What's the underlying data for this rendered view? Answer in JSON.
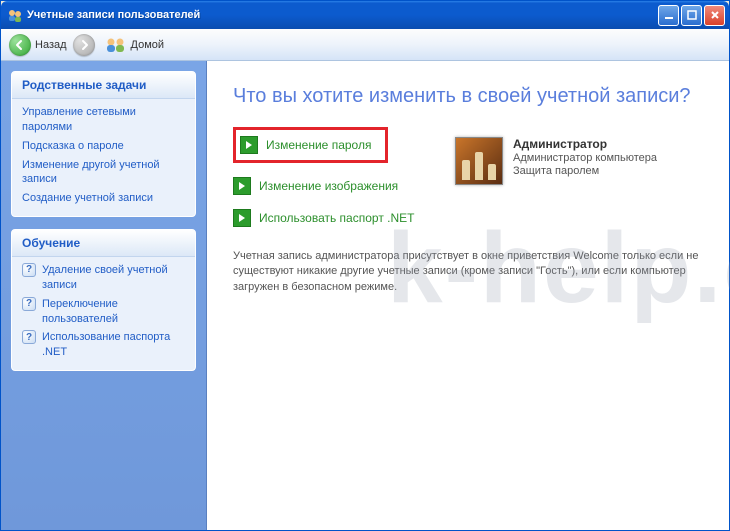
{
  "window": {
    "title": "Учетные записи пользователей"
  },
  "toolbar": {
    "back_label": "Назад",
    "home_label": "Домой"
  },
  "sidebar": {
    "panel1": {
      "title": "Родственные задачи",
      "links": [
        "Управление сетевыми паролями",
        "Подсказка о пароле",
        "Изменение другой учетной записи",
        "Создание учетной записи"
      ]
    },
    "panel2": {
      "title": "Обучение",
      "links": [
        "Удаление своей учетной записи",
        "Переключение пользователей",
        "Использование паспорта .NET"
      ]
    }
  },
  "main": {
    "heading": "Что вы хотите изменить в своей учетной записи?",
    "tasks": [
      "Изменение пароля",
      "Изменение изображения",
      "Использовать паспорт .NET"
    ],
    "account": {
      "name": "Администратор",
      "type": "Администратор компьютера",
      "protection": "Защита паролем"
    },
    "footnote": "Учетная запись администратора присутствует в окне приветствия Welcome только если не существуют никакие другие учетные записи (кроме записи \"Гость\"), или если компьютер загружен в безопасном режиме."
  },
  "watermark": "k-help.com"
}
